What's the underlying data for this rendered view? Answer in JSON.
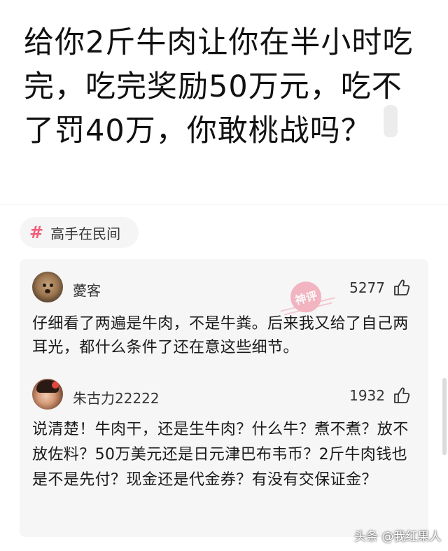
{
  "question": {
    "line1": "给你2斤牛肉让你在半小时吃",
    "line2": "完，吃完奖励50万元，吃不",
    "line3": "了罚40万，你敢桃战吗？"
  },
  "topic": {
    "icon": "hashtag-icon",
    "label": "高手在民间",
    "accent": "#f25c7a"
  },
  "comments": [
    {
      "username": "薆客",
      "likes": "5277",
      "text": "仔细看了两遍是牛肉，不是牛粪。后来我又给了自己两耳光，都什么条件了还在意这些细节。",
      "badge": "神评"
    },
    {
      "username": "朱古力22222",
      "likes": "1932",
      "text": "说清楚！牛肉干，还是生牛肉？什么牛？煮不煮？放不放佐料？50万美元还是日元津巴布韦币？2斤牛肉钱也是不是先付？现金还是代金券？有没有交保证金？"
    }
  ],
  "watermark": "头条 @我红果人"
}
